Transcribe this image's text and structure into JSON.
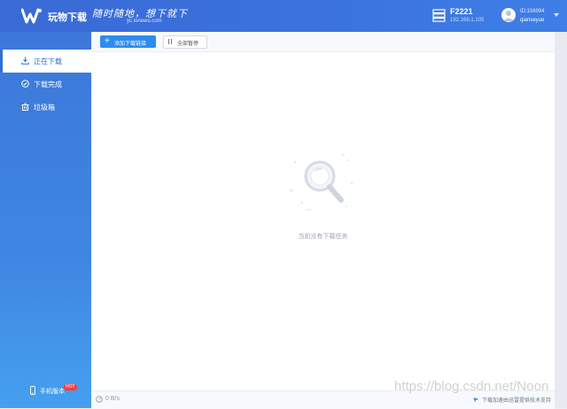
{
  "header": {
    "brand": "玩物下载",
    "slogan": "随时随地，想下就下",
    "domain": "yc.ionewu.com",
    "device": {
      "name": "F2221",
      "ip": "192.168.1.105"
    },
    "user": {
      "id": "ID:156994",
      "name": "qianseyue"
    }
  },
  "sidebar": {
    "items": [
      {
        "label": "正在下载",
        "icon": "download-icon",
        "active": true
      },
      {
        "label": "下载完成",
        "icon": "check-circle-icon",
        "active": false
      },
      {
        "label": "垃圾箱",
        "icon": "trash-icon",
        "active": false
      }
    ],
    "mobile": {
      "label": "手机版本",
      "badge": "HOT"
    }
  },
  "toolbar": {
    "add_label": "添加下载链接",
    "pause_label": "全部暂停"
  },
  "main": {
    "empty_text": "当前没有下载任务"
  },
  "statusbar": {
    "speed": "0 B/s",
    "tech_text": "下载加速由迅雷提供技术支持"
  },
  "watermark": "https://blog.csdn.net/Noon",
  "colors": {
    "accent": "#2d8cf0",
    "header": "#3a6ad6",
    "sidebar_bottom": "#45a0ee"
  }
}
